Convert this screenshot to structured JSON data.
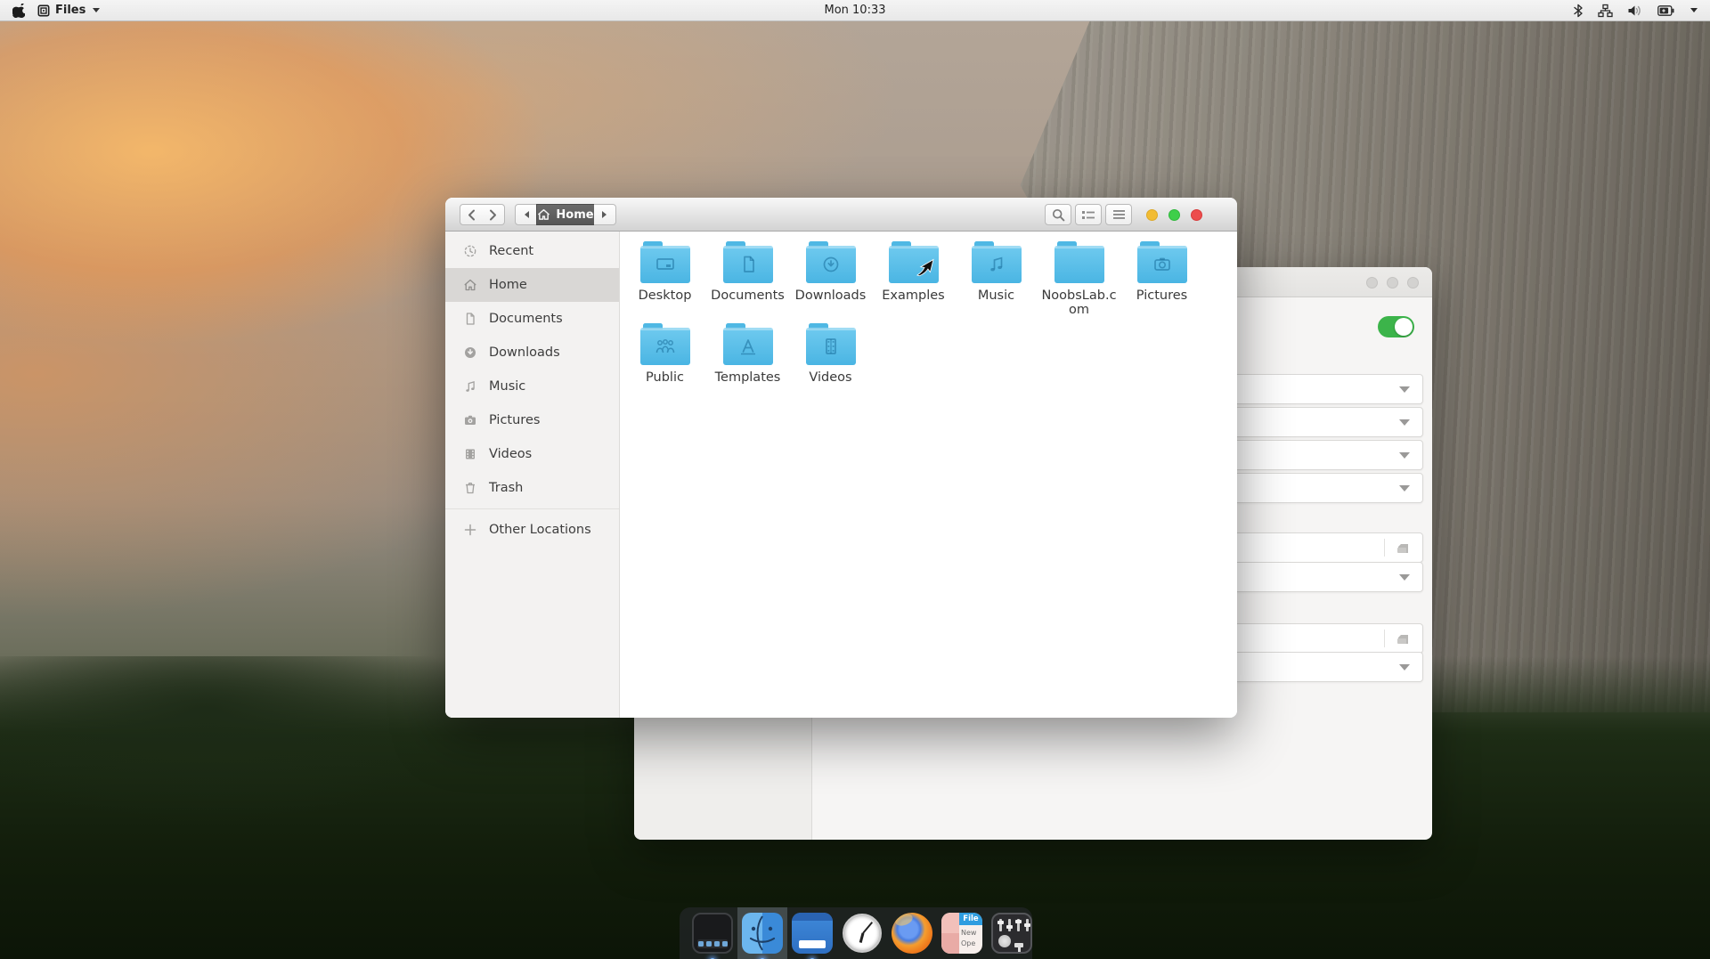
{
  "menu_bar": {
    "app_menu_label": "Files",
    "clock": "Mon 10:33",
    "status_icons": [
      "bluetooth-icon",
      "network-icon",
      "volume-icon",
      "battery-icon",
      "caret-down-icon"
    ]
  },
  "files_window": {
    "path_current": "Home",
    "toolbar_icons": [
      "search-icon",
      "list-view-icon",
      "hamburger-menu-icon"
    ],
    "window_buttons": [
      "minimize",
      "maximize",
      "close"
    ],
    "sidebar": {
      "items": [
        {
          "label": "Recent",
          "icon": "recent-icon",
          "selected": false
        },
        {
          "label": "Home",
          "icon": "home-icon",
          "selected": true
        },
        {
          "label": "Documents",
          "icon": "document-icon",
          "selected": false
        },
        {
          "label": "Downloads",
          "icon": "download-icon",
          "selected": false
        },
        {
          "label": "Music",
          "icon": "music-note-icon",
          "selected": false
        },
        {
          "label": "Pictures",
          "icon": "camera-icon",
          "selected": false
        },
        {
          "label": "Videos",
          "icon": "film-icon",
          "selected": false
        },
        {
          "label": "Trash",
          "icon": "trash-icon",
          "selected": false
        }
      ],
      "other_locations_label": "Other Locations"
    },
    "folders": [
      {
        "name": "Desktop",
        "emblem": "screen"
      },
      {
        "name": "Documents",
        "emblem": "document"
      },
      {
        "name": "Downloads",
        "emblem": "download"
      },
      {
        "name": "Examples",
        "emblem": "none"
      },
      {
        "name": "Music",
        "emblem": "music"
      },
      {
        "name": "NoobsLab.com",
        "emblem": "none"
      },
      {
        "name": "Pictures",
        "emblem": "camera"
      },
      {
        "name": "Public",
        "emblem": "people"
      },
      {
        "name": "Templates",
        "emblem": "template"
      },
      {
        "name": "Videos",
        "emblem": "film"
      }
    ]
  },
  "background_window": {
    "window_dots": 3,
    "toggle_state": "on",
    "rows": [
      "dropdown",
      "dropdown",
      "dropdown",
      "dropdown",
      "entry-with-file-button",
      "dropdown",
      "entry-with-file-button",
      "dropdown"
    ]
  },
  "dock": {
    "items": [
      {
        "name": "dock-preferences",
        "running": true
      },
      {
        "name": "finder",
        "running": true,
        "active": true
      },
      {
        "name": "desktop",
        "running": true
      },
      {
        "name": "clock",
        "running": false
      },
      {
        "name": "firefox",
        "running": false
      },
      {
        "name": "recent-files",
        "running": false
      },
      {
        "name": "tweak-tool",
        "running": false
      }
    ],
    "recent_files_icon_text": {
      "header": "File",
      "line1": "New",
      "line2": "Ope"
    }
  },
  "colors": {
    "folder_blue": "#4ab5e3",
    "toggle_green": "#3cb44a",
    "traffic_yellow": "#f2bc33",
    "traffic_green": "#3ecf4a",
    "traffic_red": "#ec4d4d",
    "sidebar_selected": "#d9d7d5"
  }
}
